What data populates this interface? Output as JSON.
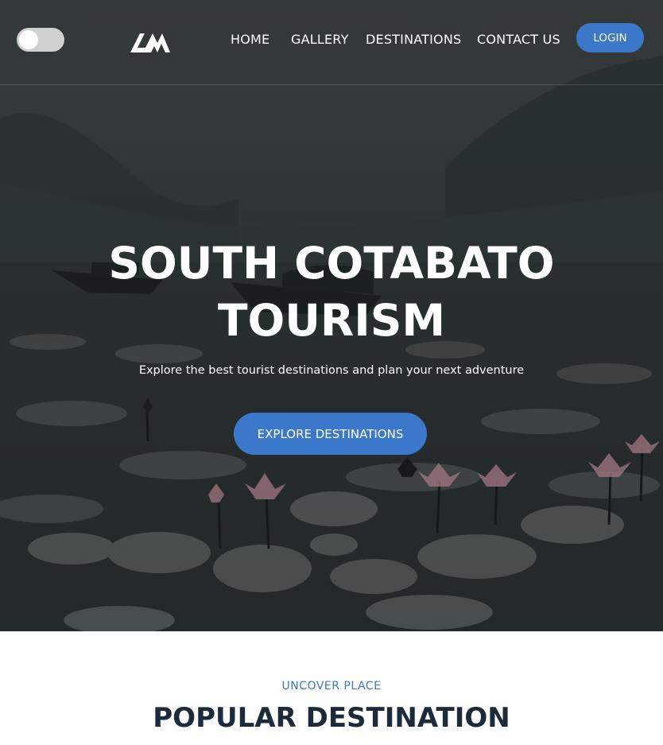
{
  "nav": {
    "theme_toggle_state": "off",
    "links": [
      "HOME",
      "GALLERY",
      "DESTINATIONS",
      "CONTACT US"
    ],
    "login_label": "LOGIN"
  },
  "hero": {
    "title_line1": "SOUTH COTABATO",
    "title_line2": "TOURISM",
    "subtitle": "Explore the best tourist destinations and plan your next adventure",
    "cta_label": "EXPLORE DESTINATIONS"
  },
  "section": {
    "eyebrow": "UNCOVER PLACE",
    "title": "POPULAR DESTINATION"
  },
  "colors": {
    "accent": "#3b78c9",
    "heading_dark": "#1c2a3a",
    "hero_overlay": "#2f3535"
  }
}
